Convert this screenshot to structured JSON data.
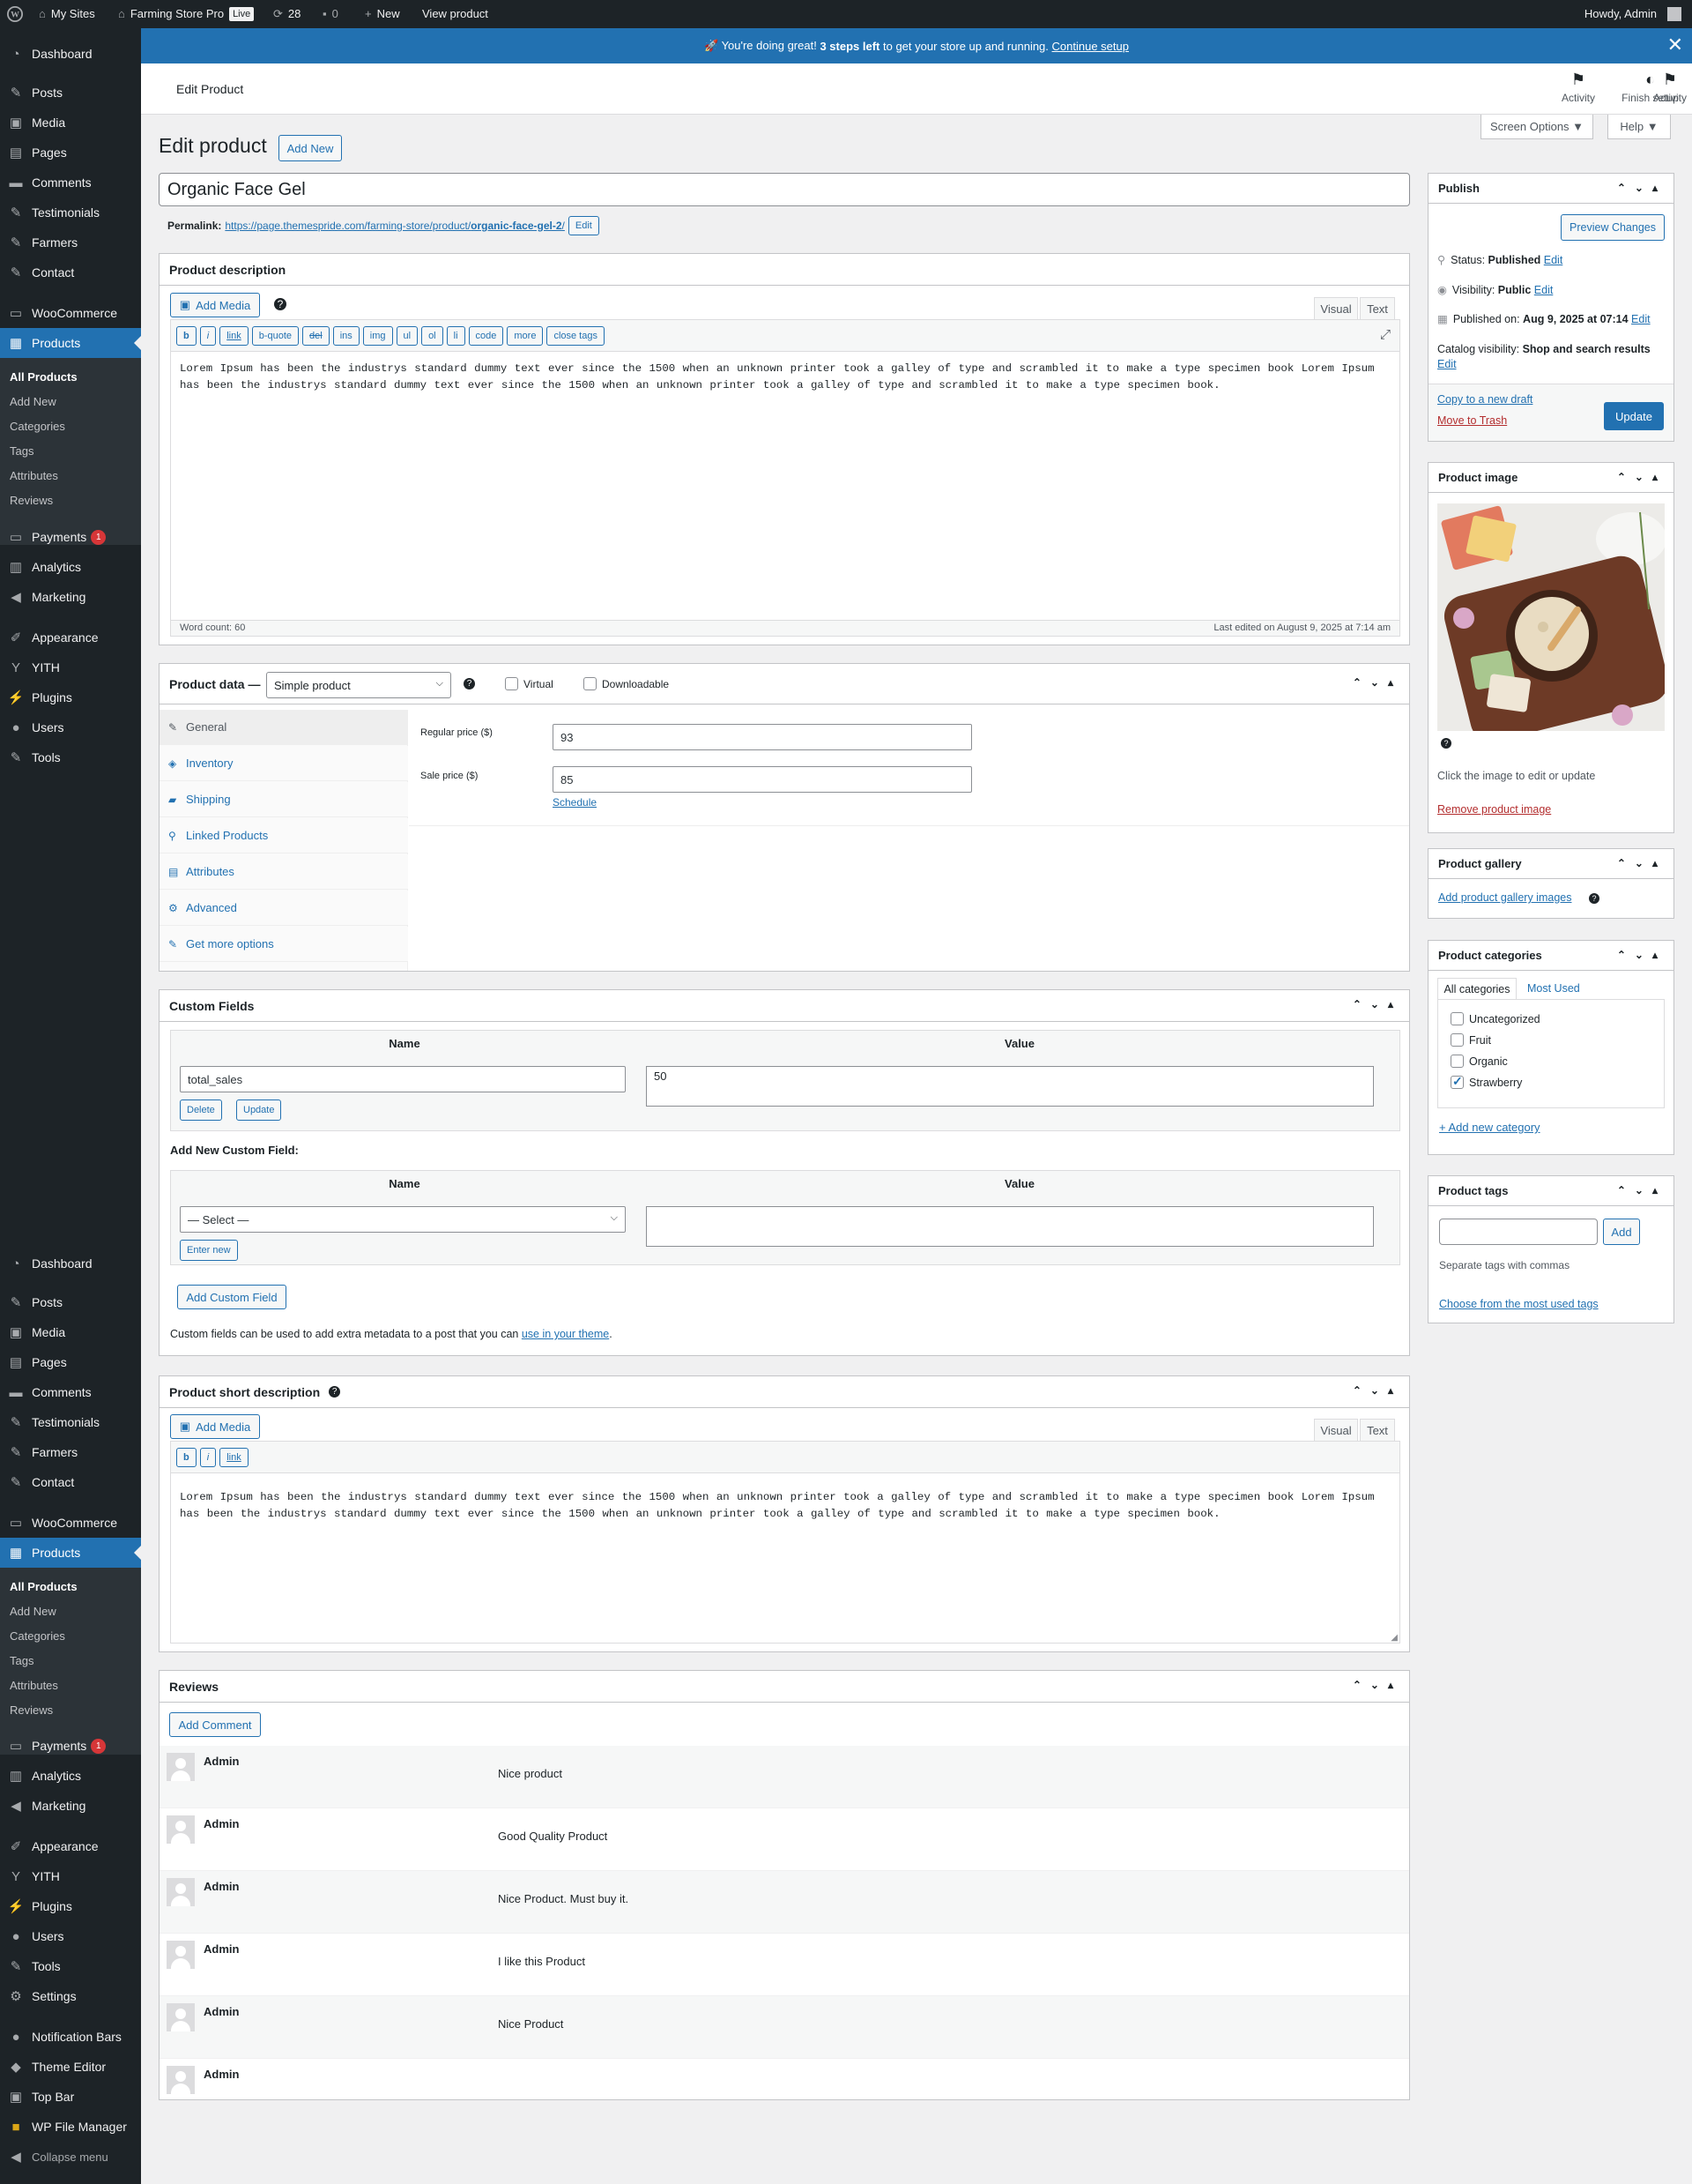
{
  "adminbar": {
    "my_sites": "My Sites",
    "site_name": "Farming Store Pro",
    "live_badge": "Live",
    "updates_count": "28",
    "comments_count": "0",
    "new": "New",
    "view_product": "View product",
    "howdy": "Howdy, Admin"
  },
  "sidebar": {
    "dashboard": "Dashboard",
    "posts": "Posts",
    "media": "Media",
    "pages": "Pages",
    "comments": "Comments",
    "testimonials": "Testimonials",
    "farmers": "Farmers",
    "contact": "Contact",
    "woocommerce": "WooCommerce",
    "products": "Products",
    "sub": [
      "All Products",
      "Add New",
      "Categories",
      "Tags",
      "Attributes",
      "Reviews"
    ],
    "payments": "Payments",
    "payments_badge": "1",
    "analytics": "Analytics",
    "marketing": "Marketing",
    "appearance": "Appearance",
    "yith": "YITH",
    "plugins": "Plugins",
    "users": "Users",
    "tools": "Tools",
    "settings": "Settings",
    "notification_bars": "Notification Bars",
    "theme_editor": "Theme Editor",
    "top_bar": "Top Bar",
    "file_manager": "WP File Manager",
    "collapse": "Collapse menu"
  },
  "notice": {
    "prefix": "🚀 You're doing great! ",
    "bold": "3 steps left",
    "suffix": " to get your store up and running. ",
    "link": "Continue setup"
  },
  "header": {
    "title": "Edit Product",
    "activity": "Activity",
    "finish_setup": "Finish setup",
    "screen_options": "Screen Options ▼",
    "help": "Help ▼"
  },
  "page": {
    "heading": "Edit product",
    "add_new": "Add New",
    "product_title": "Organic Face Gel",
    "permalink_label": "Permalink:",
    "permalink_base": "https://page.themespride.com/farming-store/product/",
    "permalink_slug": "organic-face-gel-2",
    "permalink_trail": "/",
    "permalink_edit": "Edit"
  },
  "description": {
    "title": "Product description",
    "add_media": "Add Media",
    "tab_visual": "Visual",
    "tab_text": "Text",
    "quicktags": [
      "b",
      "i",
      "link",
      "b-quote",
      "del",
      "ins",
      "img",
      "ul",
      "ol",
      "li",
      "code",
      "more",
      "close tags"
    ],
    "content": "Lorem Ipsum has been the industrys standard dummy text ever since the 1500 when an unknown printer took a galley of type and scrambled it to make a type specimen book Lorem Ipsum has been the industrys standard dummy text ever since the 1500 when an unknown printer took a galley of type and scrambled it to make a type specimen book.",
    "word_count": "Word count: 60",
    "last_edited": "Last edited on August 9, 2025 at 7:14 am"
  },
  "product_data": {
    "title": "Product data —",
    "type_selected": "Simple product",
    "virtual": "Virtual",
    "downloadable": "Downloadable",
    "tabs": [
      "General",
      "Inventory",
      "Shipping",
      "Linked Products",
      "Attributes",
      "Advanced",
      "Get more options"
    ],
    "regular_price_label": "Regular price ($)",
    "regular_price": "93",
    "sale_price_label": "Sale price ($)",
    "sale_price": "85",
    "schedule": "Schedule"
  },
  "custom_fields": {
    "title": "Custom Fields",
    "col_name": "Name",
    "col_value": "Value",
    "field_name": "total_sales",
    "field_value": "50",
    "delete": "Delete",
    "update": "Update",
    "add_new_label": "Add New Custom Field:",
    "select_placeholder": "— Select —",
    "enter_new": "Enter new",
    "add_button": "Add Custom Field",
    "help_prefix": "Custom fields can be used to add extra metadata to a post that you can ",
    "help_link": "use in your theme",
    "help_suffix": "."
  },
  "short_description": {
    "title": "Product short description",
    "add_media": "Add Media",
    "tab_visual": "Visual",
    "tab_text": "Text",
    "quicktags": [
      "b",
      "i",
      "link"
    ],
    "content": "Lorem Ipsum has been the industrys standard dummy text ever since the 1500 when an unknown printer took a galley of type and scrambled it to make a type specimen book Lorem Ipsum has been the industrys standard dummy text ever since the 1500 when an unknown printer took a galley of type and scrambled it to make a type specimen book."
  },
  "reviews": {
    "title": "Reviews",
    "add_comment": "Add Comment",
    "items": [
      {
        "author": "Admin",
        "text": "Nice product"
      },
      {
        "author": "Admin",
        "text": "Good Quality Product"
      },
      {
        "author": "Admin",
        "text": "Nice Product. Must buy it."
      },
      {
        "author": "Admin",
        "text": "I like this Product"
      },
      {
        "author": "Admin",
        "text": "Nice Product"
      },
      {
        "author": "Admin",
        "text": ""
      }
    ]
  },
  "publish": {
    "title": "Publish",
    "preview": "Preview Changes",
    "status_label": "Status: ",
    "status_value": "Published",
    "visibility_label": "Visibility: ",
    "visibility_value": "Public",
    "published_label": "Published on: ",
    "published_value": "Aug 9, 2025 at 07:14",
    "catalog_label": "Catalog visibility: ",
    "catalog_value": "Shop and search results",
    "edit": "Edit",
    "copy_draft": "Copy to a new draft",
    "trash": "Move to Trash",
    "update": "Update"
  },
  "product_image": {
    "title": "Product image",
    "hint": "Click the image to edit or update",
    "remove": "Remove product image"
  },
  "gallery": {
    "title": "Product gallery",
    "add": "Add product gallery images"
  },
  "categories": {
    "title": "Product categories",
    "tab_all": "All categories",
    "tab_used": "Most Used",
    "items": [
      {
        "label": "Uncategorized",
        "checked": false
      },
      {
        "label": "Fruit",
        "checked": false
      },
      {
        "label": "Organic",
        "checked": false
      },
      {
        "label": "Strawberry",
        "checked": true
      }
    ],
    "add_new": "+ Add new category"
  },
  "tags": {
    "title": "Product tags",
    "add": "Add",
    "hint": "Separate tags with commas",
    "choose": "Choose from the most used tags"
  }
}
